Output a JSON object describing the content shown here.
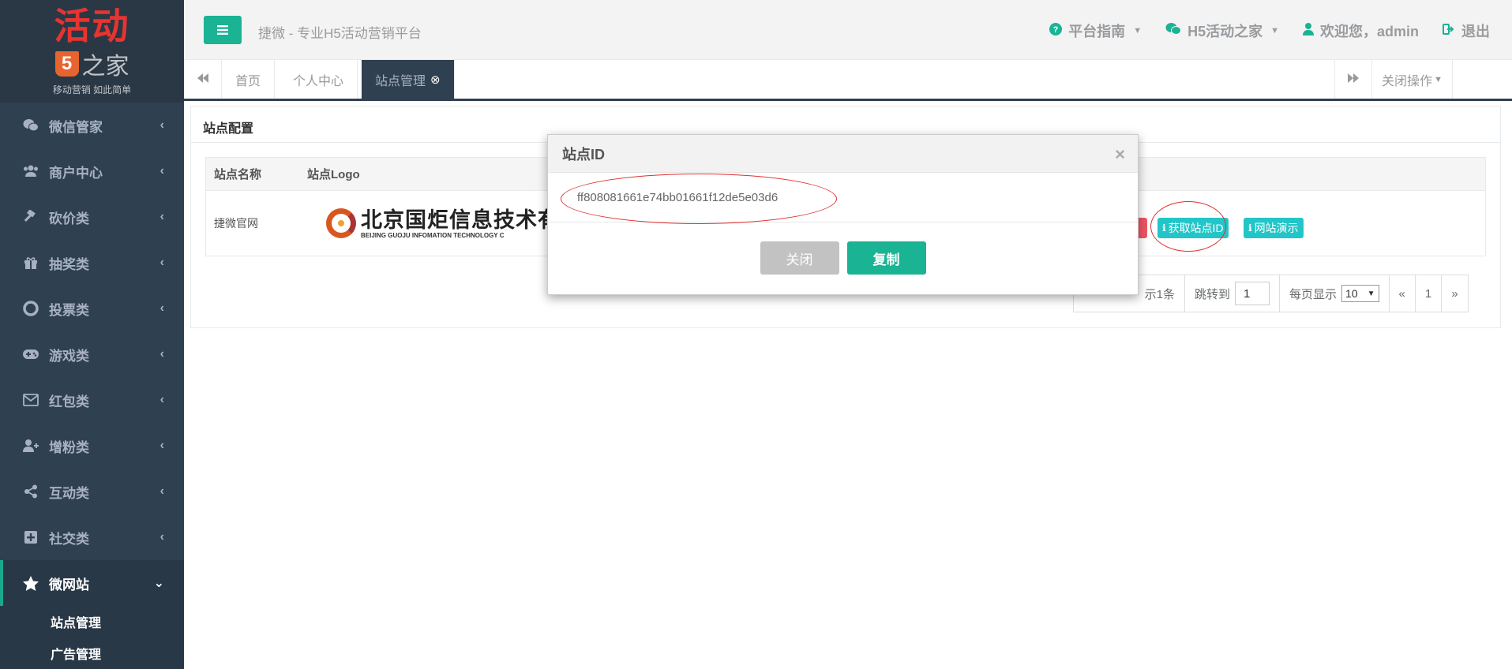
{
  "sidebar": {
    "logo": {
      "main": "活动",
      "five": "5",
      "home": "之家",
      "tagline": "移动营销 如此简单"
    },
    "items": [
      {
        "label": "微信管家",
        "icon": "wechat-icon"
      },
      {
        "label": "商户中心",
        "icon": "users-icon"
      },
      {
        "label": "砍价类",
        "icon": "gavel-icon"
      },
      {
        "label": "抽奖类",
        "icon": "gift-icon"
      },
      {
        "label": "投票类",
        "icon": "lifebuoy-icon"
      },
      {
        "label": "游戏类",
        "icon": "gamepad-icon"
      },
      {
        "label": "红包类",
        "icon": "envelope-icon"
      },
      {
        "label": "增粉类",
        "icon": "user-plus-icon"
      },
      {
        "label": "互动类",
        "icon": "share-icon"
      },
      {
        "label": "社交类",
        "icon": "plus-square-icon"
      },
      {
        "label": "微网站",
        "icon": "star-icon",
        "active": true
      }
    ],
    "submenu": [
      "站点管理",
      "广告管理"
    ]
  },
  "header": {
    "site_title": "捷微 - 专业H5活动营销平台",
    "guide": "平台指南",
    "home": "H5活动之家",
    "welcome": "欢迎您，admin",
    "logout": "退出"
  },
  "tabs": {
    "items": [
      "首页",
      "个人中心",
      "站点管理"
    ],
    "active": "站点管理",
    "close_ops": "关闭操作"
  },
  "panel": {
    "title": "站点配置",
    "columns": [
      "站点名称",
      "站点Logo"
    ],
    "rows": [
      {
        "name": "捷微官网",
        "logo_cn": "北京国炬信息技术有",
        "logo_en": "BEIJING GUOJU INFOMATION TECHNOLOGY C"
      }
    ],
    "actions": {
      "get_id": "获取站点ID",
      "demo": "网站演示"
    }
  },
  "pager": {
    "summary": "示1条",
    "jump_label": "跳转到",
    "jump_value": "1",
    "per_page_label": "每页显示",
    "per_page_value": "10",
    "prev": "«",
    "page": "1",
    "next": "»"
  },
  "modal": {
    "title": "站点ID",
    "site_id": "ff808081661e74bb01661f12de5e03d6",
    "close_label": "关闭",
    "copy_label": "复制"
  },
  "colors": {
    "primary": "#1ab394",
    "sidebar": "#2f4050",
    "info": "#23c6c8",
    "danger": "#ed5565",
    "annotation": "#e03030"
  }
}
